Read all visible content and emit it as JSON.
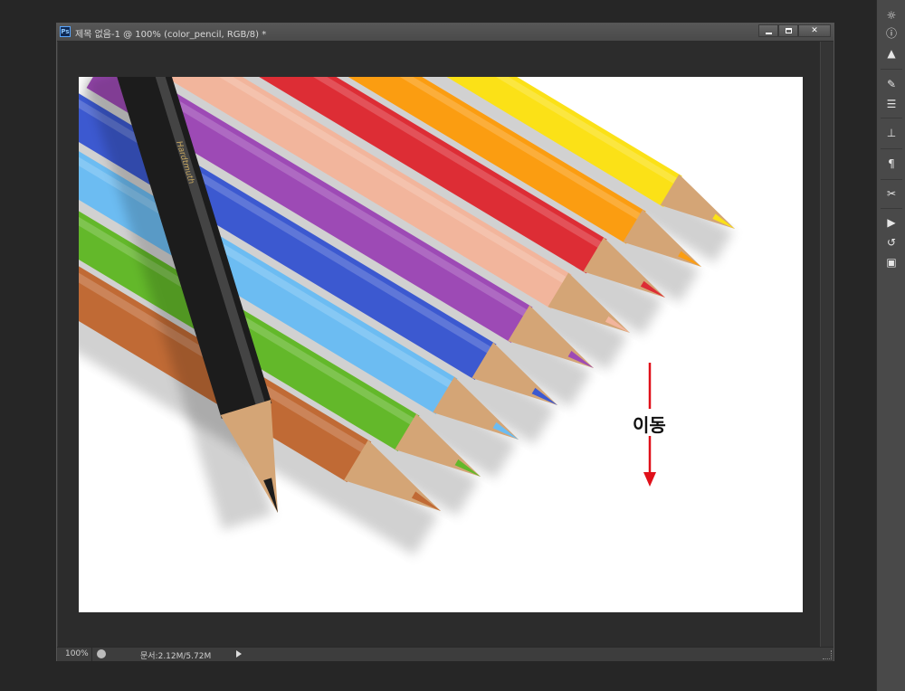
{
  "window": {
    "title": "제목 없음-1 @ 100% (color_pencil, RGB/8) *",
    "app_icon_text": "Ps"
  },
  "canvas": {
    "annotation": "이동",
    "pencil_logo": "Hardtmuth",
    "arrow_color": "#e0101a",
    "pencil_colors": [
      "#1c1c1c",
      "#c06a35",
      "#63b82a",
      "#6cbcf2",
      "#3c59d0",
      "#9d4ab5",
      "#f2b59c",
      "#dd2d35",
      "#fb9d11",
      "#fbe117"
    ]
  },
  "status": {
    "zoom": "100%",
    "doc_size": "문서:2.12M/5.72M"
  },
  "panel": {
    "icons": [
      "brightness-icon",
      "info-icon",
      "histogram-icon",
      "brush-tool-icon",
      "adjustments-icon",
      "clone-stamp-icon",
      "paragraph-icon",
      "tools-icon",
      "play-icon",
      "history-icon",
      "properties-icon"
    ]
  }
}
